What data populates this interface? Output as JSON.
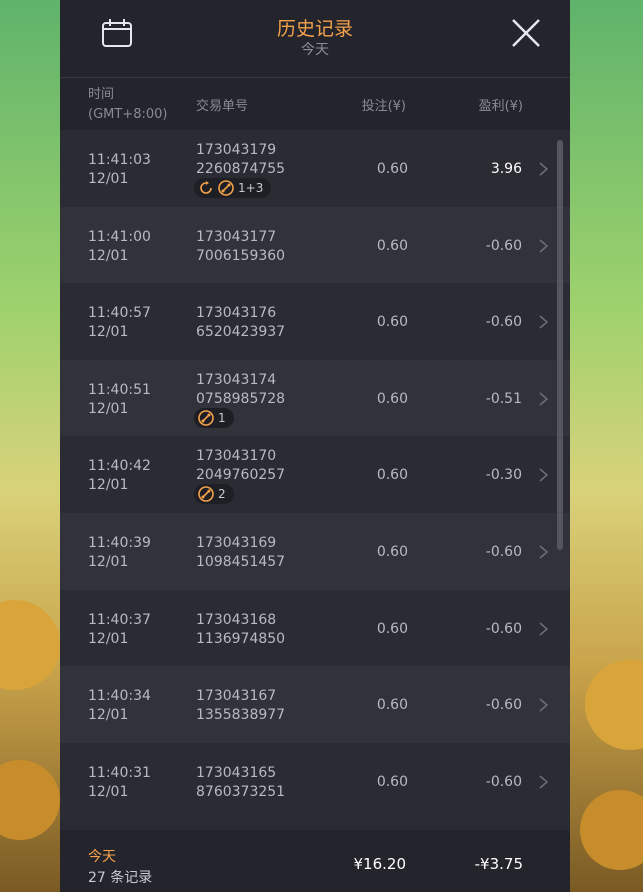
{
  "header": {
    "title": "历史记录",
    "subtitle": "今天",
    "calendar_icon": "calendar-icon",
    "close_icon": "close-icon"
  },
  "columns": {
    "time_label": "时间",
    "timezone": "(GMT+8:00)",
    "order_label": "交易单号",
    "bet_label": "投注(¥)",
    "profit_label": "盈利(¥)"
  },
  "rows": [
    {
      "time": "11:41:03",
      "date": "12/01",
      "order_1": "173043179",
      "order_2": "2260874755",
      "bet": "0.60",
      "profit": "3.96",
      "badge": "1+3",
      "badge_icons": [
        "refresh-icon",
        "bonus-icon"
      ]
    },
    {
      "time": "11:41:00",
      "date": "12/01",
      "order_1": "173043177",
      "order_2": "7006159360",
      "bet": "0.60",
      "profit": "-0.60"
    },
    {
      "time": "11:40:57",
      "date": "12/01",
      "order_1": "173043176",
      "order_2": "6520423937",
      "bet": "0.60",
      "profit": "-0.60"
    },
    {
      "time": "11:40:51",
      "date": "12/01",
      "order_1": "173043174",
      "order_2": "0758985728",
      "bet": "0.60",
      "profit": "-0.51",
      "badge": "1",
      "badge_icons": [
        "bonus-icon"
      ]
    },
    {
      "time": "11:40:42",
      "date": "12/01",
      "order_1": "173043170",
      "order_2": "2049760257",
      "bet": "0.60",
      "profit": "-0.30",
      "badge": "2",
      "badge_icons": [
        "bonus-icon"
      ]
    },
    {
      "time": "11:40:39",
      "date": "12/01",
      "order_1": "173043169",
      "order_2": "1098451457",
      "bet": "0.60",
      "profit": "-0.60"
    },
    {
      "time": "11:40:37",
      "date": "12/01",
      "order_1": "173043168",
      "order_2": "1136974850",
      "bet": "0.60",
      "profit": "-0.60"
    },
    {
      "time": "11:40:34",
      "date": "12/01",
      "order_1": "173043167",
      "order_2": "1355838977",
      "bet": "0.60",
      "profit": "-0.60"
    },
    {
      "time": "11:40:31",
      "date": "12/01",
      "order_1": "173043165",
      "order_2": "8760373251",
      "bet": "0.60",
      "profit": "-0.60"
    }
  ],
  "footer": {
    "period": "今天",
    "count": "27 条记录",
    "total_bet": "¥16.20",
    "total_profit": "-¥3.75"
  },
  "colors": {
    "accent": "#f4a24a",
    "panel": "#2a2a33",
    "header": "#24242c"
  }
}
